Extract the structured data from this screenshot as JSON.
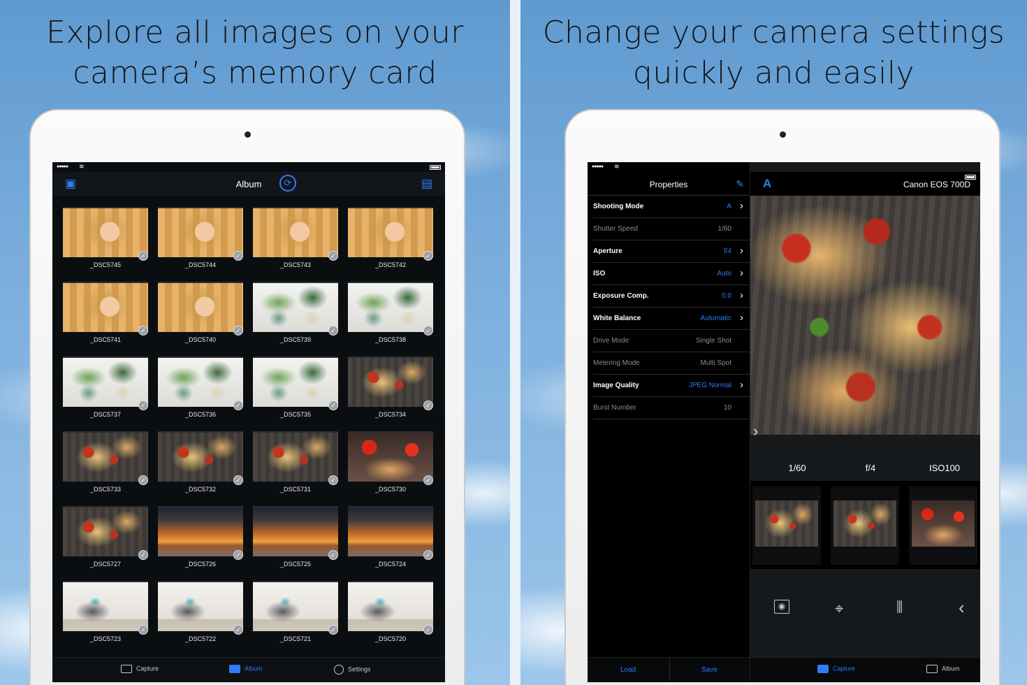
{
  "left": {
    "headline": [
      "Explore all images on your",
      "camera’s memory card"
    ],
    "nav_title": "Album",
    "thumbs": [
      {
        "label": "_DSC5745",
        "type": "portrait"
      },
      {
        "label": "_DSC5744",
        "type": "portrait"
      },
      {
        "label": "_DSC5743",
        "type": "portrait"
      },
      {
        "label": "_DSC5742",
        "type": "portrait"
      },
      {
        "label": "_DSC5741",
        "type": "portrait"
      },
      {
        "label": "_DSC5740",
        "type": "portrait"
      },
      {
        "label": "_DSC5739",
        "type": "plant"
      },
      {
        "label": "_DSC5738",
        "type": "plant"
      },
      {
        "label": "_DSC5737",
        "type": "plant"
      },
      {
        "label": "_DSC5736",
        "type": "plant"
      },
      {
        "label": "_DSC5735",
        "type": "plant"
      },
      {
        "label": "_DSC5734",
        "type": "pizza"
      },
      {
        "label": "_DSC5733",
        "type": "pizza"
      },
      {
        "label": "_DSC5732",
        "type": "pizza"
      },
      {
        "label": "_DSC5731",
        "type": "pizza"
      },
      {
        "label": "_DSC5730",
        "type": "pizza2"
      },
      {
        "label": "_DSC5727",
        "type": "pizza"
      },
      {
        "label": "_DSC5726",
        "type": "sunset"
      },
      {
        "label": "_DSC5725",
        "type": "sunset"
      },
      {
        "label": "_DSC5724",
        "type": "sunset"
      },
      {
        "label": "_DSC5723",
        "type": "chair"
      },
      {
        "label": "_DSC5722",
        "type": "chair"
      },
      {
        "label": "_DSC5721",
        "type": "chair"
      },
      {
        "label": "_DSC5720",
        "type": "chair"
      }
    ],
    "tabs": [
      {
        "label": "Capture",
        "icon": "camera-icon",
        "active": false
      },
      {
        "label": "Album",
        "icon": "album-icon",
        "active": true
      },
      {
        "label": "Settings",
        "icon": "gear-icon",
        "active": false
      }
    ]
  },
  "right": {
    "headline": [
      "Change your camera settings",
      "quickly and easily"
    ],
    "properties_title": "Properties",
    "camera_name": "Canon EOS 700D",
    "mode_letter": "A",
    "properties": [
      {
        "label": "Shooting Mode",
        "value": "A",
        "enabled": true
      },
      {
        "label": "Shutter Speed",
        "value": "1/60",
        "enabled": false
      },
      {
        "label": "Aperture",
        "value": "f/4",
        "enabled": true
      },
      {
        "label": "ISO",
        "value": "Auto",
        "enabled": true
      },
      {
        "label": "Exposure Comp.",
        "value": "0.0",
        "enabled": true
      },
      {
        "label": "White Balance",
        "value": "Automatic",
        "enabled": true
      },
      {
        "label": "Drive Mode",
        "value": "Single Shot",
        "enabled": false
      },
      {
        "label": "Metering Mode",
        "value": "Multi Spot",
        "enabled": false
      },
      {
        "label": "Image Quality",
        "value": "JPEG Normal",
        "enabled": true
      },
      {
        "label": "Burst Number",
        "value": "10",
        "enabled": false
      }
    ],
    "exposure": {
      "shutter": "1/60",
      "aperture": "f/4",
      "iso": "ISO100"
    },
    "bottom_buttons": {
      "load": "Load",
      "save": "Save"
    },
    "tabs": [
      {
        "label": "Capture",
        "icon": "camera-icon",
        "active": true
      },
      {
        "label": "Album",
        "icon": "album-icon",
        "active": false
      }
    ]
  },
  "accent_color": "#2f7cf6"
}
